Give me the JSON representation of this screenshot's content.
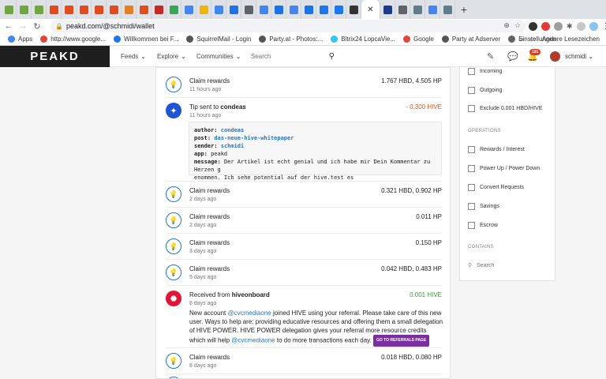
{
  "browser": {
    "tab_colors": [
      "#6fa83a",
      "#6fa83a",
      "#6fa83a",
      "#e64a19",
      "#e64a19",
      "#e64a19",
      "#e64a19",
      "#e64a19",
      "#e67e22",
      "#e64a19",
      "#c62828",
      "#34a853",
      "#4285f4",
      "#f2b400",
      "#4285f4",
      "#1a73e8",
      "#5f6368",
      "#4285f4",
      "#1a73e8",
      "#4285f4",
      "#1a73e8",
      "#1877f2",
      "#1877f2",
      "#333333",
      "#1b3c8c",
      "#5f6368",
      "#607d8b",
      "#4285f4",
      "#607d8b"
    ],
    "active_tab_icon": "close-icon",
    "new_tab": "+",
    "close_glyph": "✕",
    "url": "peakd.com/@schmidi/wallet"
  },
  "bookmarks": {
    "items": [
      {
        "label": "Apps",
        "color": "#4285f4"
      },
      {
        "label": "http://www.google...",
        "color": "#ea4335"
      },
      {
        "label": "Willkommen bei F...",
        "color": "#1877f2"
      },
      {
        "label": "SquirrelMail - Login",
        "color": "#555555"
      },
      {
        "label": "Party.at - Photos:...",
        "color": "#555555"
      },
      {
        "label": "Bitrix24 LopcaVie...",
        "color": "#2fc6f6"
      },
      {
        "label": "Google",
        "color": "#ea4335"
      },
      {
        "label": "Party at Adserver",
        "color": "#555555"
      },
      {
        "label": "Einstellungen",
        "color": "#5f6368"
      }
    ],
    "more": "»",
    "other": "Andere Lesezeichen"
  },
  "header": {
    "logo": "PEAKD",
    "menu": [
      {
        "label": "Feeds",
        "caret": "⌄"
      },
      {
        "label": "Explore",
        "caret": "⌄"
      },
      {
        "label": "Communities",
        "caret": "⌄"
      }
    ],
    "search_placeholder": "Search",
    "notifications": "191",
    "username": "schmidi",
    "user_caret": "⌄"
  },
  "transactions": [
    {
      "type": "claim",
      "title": "Claim rewards",
      "time": "11 hours ago",
      "amount": "1.767 HBD, 4.505 HP"
    },
    {
      "type": "tip",
      "title_prefix": "Tip sent to ",
      "title_user": "condeas",
      "time": "11 hours ago",
      "amount": "- 0.300 HIVE",
      "details": {
        "author_key": "author:",
        "author": "condeas",
        "post_key": "post:",
        "post": "das-neue-hive-whitepaper",
        "sender_key": "sender:",
        "sender": "schmidi",
        "app_key": "app:",
        "app": "peakd",
        "message_key": "message:",
        "message": "Der Artikel ist echt genial und ich habe mir Dein Kommentar zu Herzen g",
        "message_line2": "enommen. Ich sehe potential auf der hive.test es"
      }
    },
    {
      "type": "claim",
      "title": "Claim rewards",
      "time": "2 days ago",
      "amount": "0.321 HBD, 0.902 HP"
    },
    {
      "type": "claim",
      "title": "Claim rewards",
      "time": "2 days ago",
      "amount": "0.011 HP"
    },
    {
      "type": "claim",
      "title": "Claim rewards",
      "time": "3 days ago",
      "amount": "0.150 HP"
    },
    {
      "type": "claim",
      "title": "Claim rewards",
      "time": "5 days ago",
      "amount": "0.042 HBD, 0.483 HP"
    },
    {
      "type": "received",
      "title_prefix": "Received from ",
      "title_user": "hiveonboard",
      "time": "8 days ago",
      "amount": "0.001 HIVE",
      "desc": {
        "p1": "New account ",
        "link1": "@cvcmediaone",
        "p2": " joined HIVE using your referral. Please take care of this new user. Ways to help are: providing educative resources and offering them a small delegation of HIVE POWER. HIVE POWER delegation gives your referral more resource credits which will help ",
        "link2": "@cvcmediaone",
        "p3": " to do more transactions each day. ",
        "button": "GO TO REFERRALS PAGE"
      }
    },
    {
      "type": "claim",
      "title": "Claim rewards",
      "time": "8 days ago",
      "amount": "0.018 HBD, 0.080 HP"
    }
  ],
  "icons": {
    "claim": "💡",
    "tip": "✦",
    "received": "⬣"
  },
  "filters": {
    "top": [
      "Incoming",
      "Outgoing",
      "Exclude 0.001 HBD/HIVE"
    ],
    "operations_label": "OPERATIONS",
    "operations": [
      "Rewards / Interest",
      "Power Up / Power Down",
      "Convert Requests",
      "Savings",
      "Escrow"
    ],
    "contains_label": "CONTAINS",
    "search_placeholder": "Search"
  }
}
